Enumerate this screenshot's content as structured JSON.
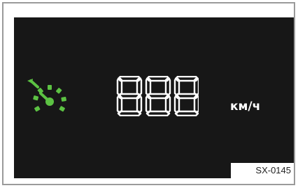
{
  "display": {
    "speed_readout": "888",
    "unit": "км/ч",
    "icon": "cruise-control-speedometer-icon",
    "icon_color": "#5cc243",
    "digit_color": "#ffffff",
    "background_color": "#171717"
  },
  "figure": {
    "code": "SX-0145"
  }
}
